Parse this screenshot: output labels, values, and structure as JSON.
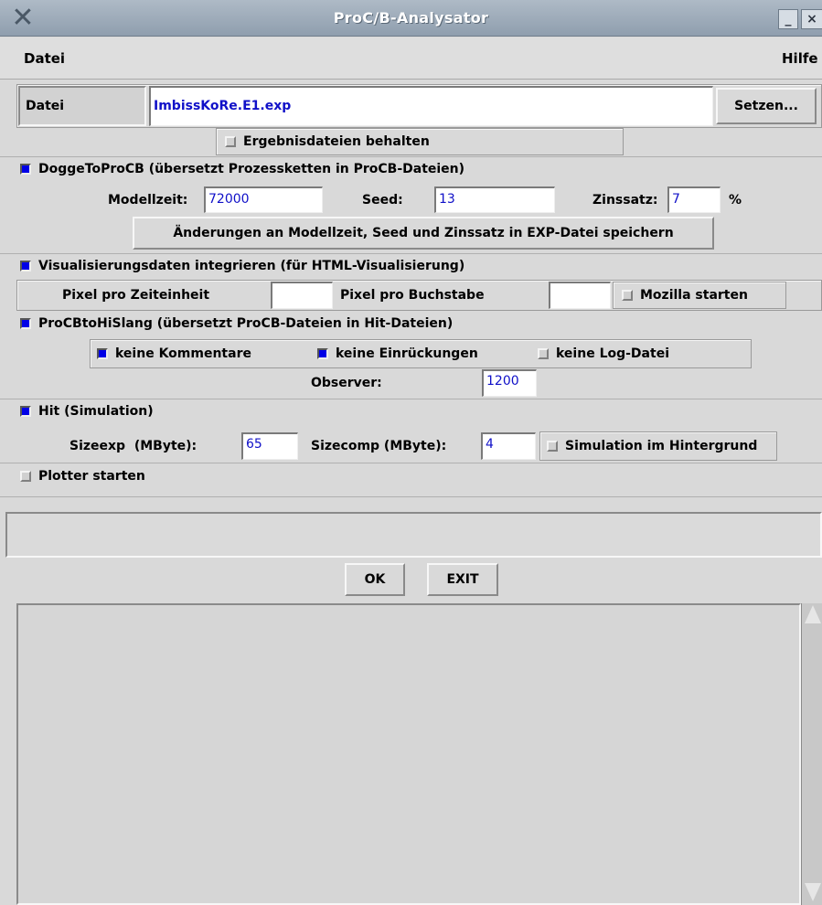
{
  "window": {
    "title": "ProC/B-Analysator",
    "minimize_label": "_",
    "close_label": "×"
  },
  "menubar": {
    "file": "Datei",
    "help": "Hilfe"
  },
  "file_row": {
    "label": "Datei",
    "value": "ImbissKoRe.E1.exp",
    "set_button": "Setzen..."
  },
  "keep_results": {
    "label": "Ergebnisdateien behalten",
    "checked": false
  },
  "dogge": {
    "label": "DoggeToProCB (übersetzt Prozessketten in ProCB-Dateien)",
    "checked": true,
    "modellzeit_label": "Modellzeit:",
    "modellzeit_value": "72000",
    "seed_label": "Seed:",
    "seed_value": "13",
    "zinssatz_label": "Zinssatz:",
    "zinssatz_value": "7",
    "percent": "%",
    "save_button": "Änderungen an Modellzeit, Seed und Zinssatz in EXP-Datei speichern"
  },
  "visual": {
    "label": "Visualisierungsdaten integrieren (für HTML-Visualisierung)",
    "checked": true,
    "pixel_time_label": "Pixel pro Zeiteinheit",
    "pixel_time_value": "",
    "pixel_char_label": "Pixel pro Buchstabe",
    "pixel_char_value": "",
    "mozilla_label": "Mozilla starten",
    "mozilla_checked": false
  },
  "hislang": {
    "label": "ProCBtoHiSlang (übersetzt ProCB-Dateien in Hit-Dateien)",
    "checked": true,
    "no_comments": "keine Kommentare",
    "no_comments_checked": true,
    "no_indent": "keine Einrückungen",
    "no_indent_checked": true,
    "no_log": "keine Log-Datei",
    "no_log_checked": false,
    "observer_label": "Observer:",
    "observer_value": "1200"
  },
  "hit": {
    "label": "Hit (Simulation)",
    "checked": true,
    "sizeexp_label": "Sizeexp  (MByte):",
    "sizeexp_value": "65",
    "sizecomp_label": "Sizecomp (MByte):",
    "sizecomp_value": "4",
    "background_label": "Simulation im Hintergrund",
    "background_checked": false
  },
  "plotter": {
    "label": "Plotter starten",
    "checked": false
  },
  "status_text": "",
  "buttons": {
    "ok": "OK",
    "exit": "EXIT"
  },
  "output_text": "",
  "colors": {
    "checkbox_on": "#0000e6",
    "entry_text": "#1010c8",
    "background": "#d9d9d9"
  }
}
